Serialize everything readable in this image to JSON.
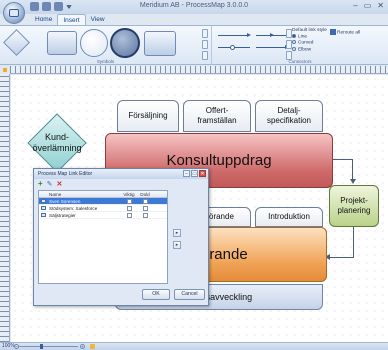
{
  "window": {
    "title": "Meridium AB - ProcessMap 3.0.0.0",
    "controls": [
      "–",
      "▭",
      "✕"
    ]
  },
  "ribbon": {
    "tabs": [
      "Home",
      "Insert",
      "View"
    ],
    "active_tab": "Insert",
    "groups": {
      "symbols": "Symbols",
      "connectors": "Connectors"
    },
    "connector_options": {
      "default_style": "Default link style",
      "line": "Line",
      "curved": "Curved",
      "elbow": "Elbow",
      "selected": "Line"
    },
    "reroute_all": "Reroute all"
  },
  "diagram": {
    "top_boxes": [
      "Försäljning",
      "Offert-\nframställan",
      "Detalj-\nspecifikation"
    ],
    "kund_diamond": "Kund-\növerlämning",
    "main_red": "Konsultuppdrag",
    "mid_boxes": [
      "Införande",
      "Introduktion"
    ],
    "main_orange": "Införande",
    "bottom_box": "Avveckling",
    "bottom_box_visible": "Avtalsavveckling",
    "green_box": "Projekt-\nplanering"
  },
  "dialog": {
    "title": "Process Map Link Editor",
    "columns": [
      "Name",
      "Viktig",
      "Dold"
    ],
    "rows": [
      {
        "name": "Sven Sorensen",
        "selected": true
      },
      {
        "name": "Stödsystem: Salesforce",
        "selected": false
      },
      {
        "name": "Säljstrategier",
        "selected": false
      }
    ],
    "ok_label": "OK",
    "cancel_label": "Cancel"
  },
  "statusbar": {
    "zoom": "100%"
  },
  "colors": {
    "accent": "#15428b",
    "red_box": "#cf6a6a",
    "orange_box": "#f0a458",
    "green_box": "#b9d28a",
    "diamond": "#8fd0d1",
    "selected_row": "#3d7ad6"
  }
}
